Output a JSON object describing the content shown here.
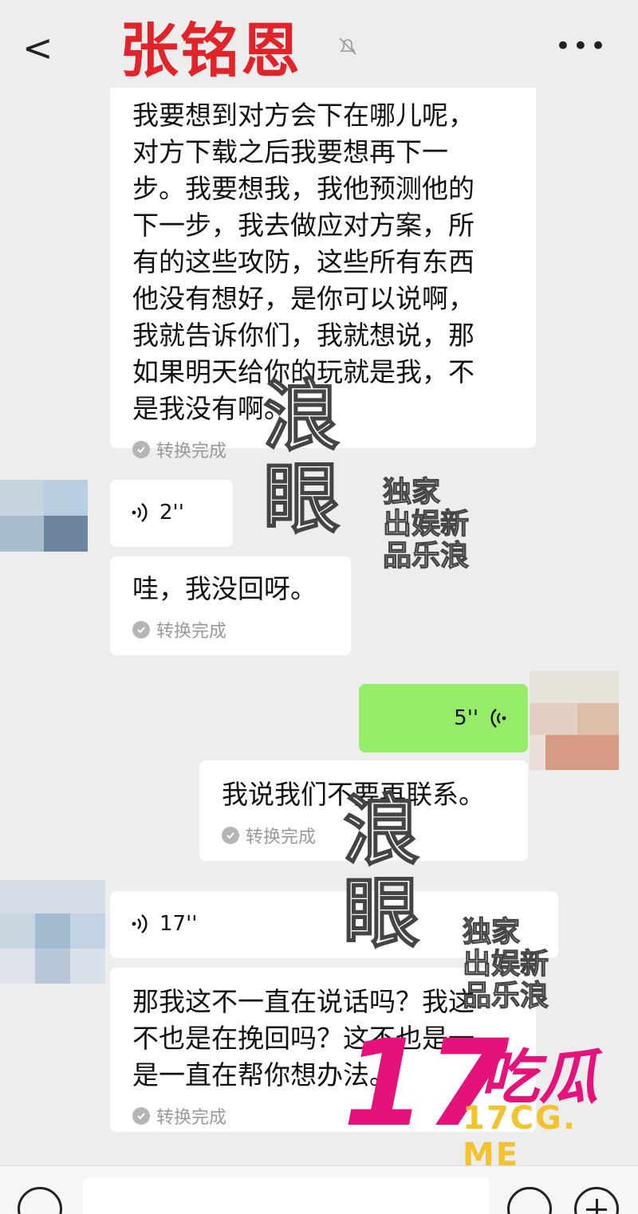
{
  "header": {
    "back_glyph": "<",
    "title": "张铭恩",
    "title_color": "#e0242a",
    "muted_icon": "bell-off-icon",
    "more_glyph": "•••"
  },
  "messages": [
    {
      "side": "left",
      "text": "我要想到对方会下在哪儿呢，\n对方下载之后我要想再下一\n步。我要想我，我他预测他的\n下一步，我去做应对方案，所\n有的这些攻防，这些所有东西\n他没有想好，是你可以说啊，\n我就告诉你们，我就想说，那\n如果明天给你的玩就是我，不\n是我没有啊。",
      "status": "转换完成"
    },
    {
      "side": "left",
      "voice_duration": "2''"
    },
    {
      "side": "left",
      "text": "哇，我没回呀。",
      "status": "转换完成"
    },
    {
      "side": "right",
      "voice_duration": "5''"
    },
    {
      "side": "right",
      "text": "我说我们不要再联系。",
      "status": "转换完成"
    },
    {
      "side": "left",
      "voice_duration": "17''"
    },
    {
      "side": "left",
      "text": "那我这不一直在说话吗？我这\n不也是在挽回吗？这不也是一\n是一直在帮你想办法。",
      "status": "转换完成"
    }
  ],
  "watermarks": {
    "main": "浪\n眼",
    "side": "独家\n出娱新\n品乐浪"
  },
  "logo": {
    "number": "17",
    "cn": "吃瓜",
    "url": "17CG. ME",
    "pink": "#e4127a",
    "yellow": "#f2c230"
  },
  "colors": {
    "bubble_white": "#ffffff",
    "bubble_green": "#95ec69",
    "background": "#ededed"
  }
}
